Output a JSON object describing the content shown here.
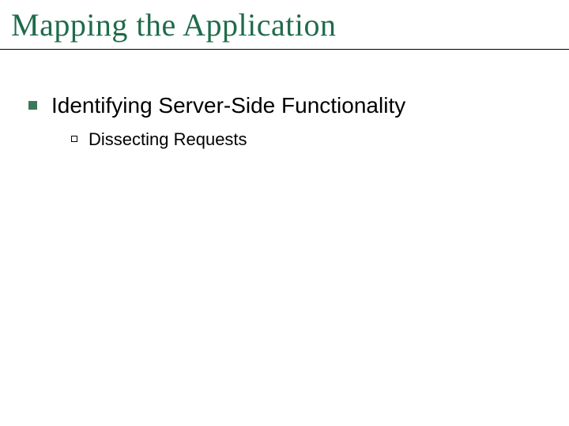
{
  "title": "Mapping the Application",
  "bullets": {
    "level1": "Identifying Server-Side Functionality",
    "level2": "Dissecting Requests"
  }
}
